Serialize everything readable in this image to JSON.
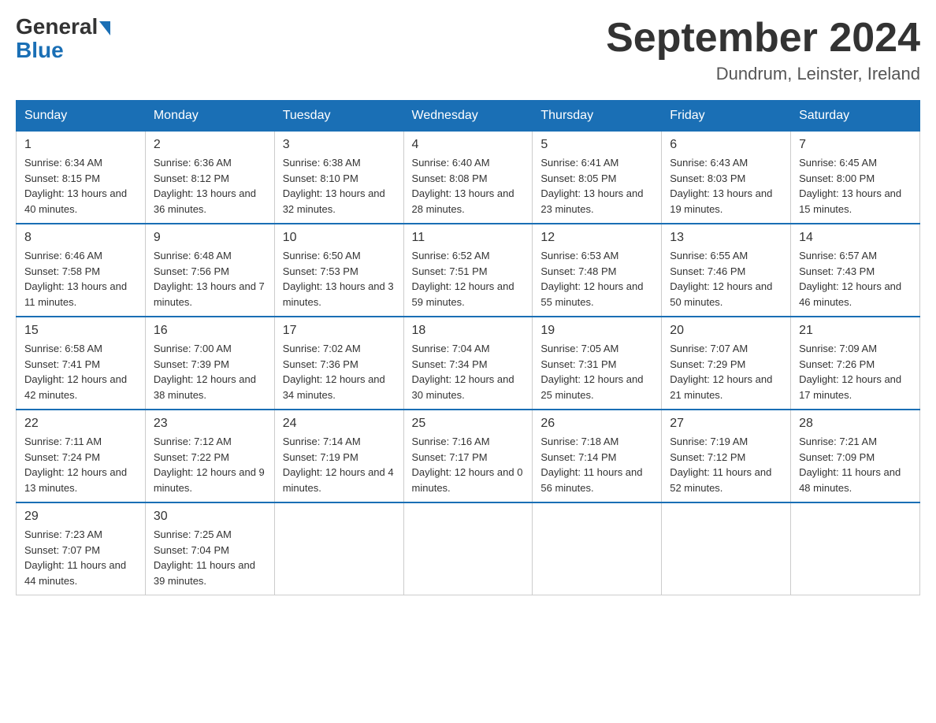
{
  "header": {
    "logo_general": "General",
    "logo_blue": "Blue",
    "month_title": "September 2024",
    "subtitle": "Dundrum, Leinster, Ireland"
  },
  "days_of_week": [
    "Sunday",
    "Monday",
    "Tuesday",
    "Wednesday",
    "Thursday",
    "Friday",
    "Saturday"
  ],
  "weeks": [
    [
      {
        "day": "1",
        "sunrise": "Sunrise: 6:34 AM",
        "sunset": "Sunset: 8:15 PM",
        "daylight": "Daylight: 13 hours and 40 minutes."
      },
      {
        "day": "2",
        "sunrise": "Sunrise: 6:36 AM",
        "sunset": "Sunset: 8:12 PM",
        "daylight": "Daylight: 13 hours and 36 minutes."
      },
      {
        "day": "3",
        "sunrise": "Sunrise: 6:38 AM",
        "sunset": "Sunset: 8:10 PM",
        "daylight": "Daylight: 13 hours and 32 minutes."
      },
      {
        "day": "4",
        "sunrise": "Sunrise: 6:40 AM",
        "sunset": "Sunset: 8:08 PM",
        "daylight": "Daylight: 13 hours and 28 minutes."
      },
      {
        "day": "5",
        "sunrise": "Sunrise: 6:41 AM",
        "sunset": "Sunset: 8:05 PM",
        "daylight": "Daylight: 13 hours and 23 minutes."
      },
      {
        "day": "6",
        "sunrise": "Sunrise: 6:43 AM",
        "sunset": "Sunset: 8:03 PM",
        "daylight": "Daylight: 13 hours and 19 minutes."
      },
      {
        "day": "7",
        "sunrise": "Sunrise: 6:45 AM",
        "sunset": "Sunset: 8:00 PM",
        "daylight": "Daylight: 13 hours and 15 minutes."
      }
    ],
    [
      {
        "day": "8",
        "sunrise": "Sunrise: 6:46 AM",
        "sunset": "Sunset: 7:58 PM",
        "daylight": "Daylight: 13 hours and 11 minutes."
      },
      {
        "day": "9",
        "sunrise": "Sunrise: 6:48 AM",
        "sunset": "Sunset: 7:56 PM",
        "daylight": "Daylight: 13 hours and 7 minutes."
      },
      {
        "day": "10",
        "sunrise": "Sunrise: 6:50 AM",
        "sunset": "Sunset: 7:53 PM",
        "daylight": "Daylight: 13 hours and 3 minutes."
      },
      {
        "day": "11",
        "sunrise": "Sunrise: 6:52 AM",
        "sunset": "Sunset: 7:51 PM",
        "daylight": "Daylight: 12 hours and 59 minutes."
      },
      {
        "day": "12",
        "sunrise": "Sunrise: 6:53 AM",
        "sunset": "Sunset: 7:48 PM",
        "daylight": "Daylight: 12 hours and 55 minutes."
      },
      {
        "day": "13",
        "sunrise": "Sunrise: 6:55 AM",
        "sunset": "Sunset: 7:46 PM",
        "daylight": "Daylight: 12 hours and 50 minutes."
      },
      {
        "day": "14",
        "sunrise": "Sunrise: 6:57 AM",
        "sunset": "Sunset: 7:43 PM",
        "daylight": "Daylight: 12 hours and 46 minutes."
      }
    ],
    [
      {
        "day": "15",
        "sunrise": "Sunrise: 6:58 AM",
        "sunset": "Sunset: 7:41 PM",
        "daylight": "Daylight: 12 hours and 42 minutes."
      },
      {
        "day": "16",
        "sunrise": "Sunrise: 7:00 AM",
        "sunset": "Sunset: 7:39 PM",
        "daylight": "Daylight: 12 hours and 38 minutes."
      },
      {
        "day": "17",
        "sunrise": "Sunrise: 7:02 AM",
        "sunset": "Sunset: 7:36 PM",
        "daylight": "Daylight: 12 hours and 34 minutes."
      },
      {
        "day": "18",
        "sunrise": "Sunrise: 7:04 AM",
        "sunset": "Sunset: 7:34 PM",
        "daylight": "Daylight: 12 hours and 30 minutes."
      },
      {
        "day": "19",
        "sunrise": "Sunrise: 7:05 AM",
        "sunset": "Sunset: 7:31 PM",
        "daylight": "Daylight: 12 hours and 25 minutes."
      },
      {
        "day": "20",
        "sunrise": "Sunrise: 7:07 AM",
        "sunset": "Sunset: 7:29 PM",
        "daylight": "Daylight: 12 hours and 21 minutes."
      },
      {
        "day": "21",
        "sunrise": "Sunrise: 7:09 AM",
        "sunset": "Sunset: 7:26 PM",
        "daylight": "Daylight: 12 hours and 17 minutes."
      }
    ],
    [
      {
        "day": "22",
        "sunrise": "Sunrise: 7:11 AM",
        "sunset": "Sunset: 7:24 PM",
        "daylight": "Daylight: 12 hours and 13 minutes."
      },
      {
        "day": "23",
        "sunrise": "Sunrise: 7:12 AM",
        "sunset": "Sunset: 7:22 PM",
        "daylight": "Daylight: 12 hours and 9 minutes."
      },
      {
        "day": "24",
        "sunrise": "Sunrise: 7:14 AM",
        "sunset": "Sunset: 7:19 PM",
        "daylight": "Daylight: 12 hours and 4 minutes."
      },
      {
        "day": "25",
        "sunrise": "Sunrise: 7:16 AM",
        "sunset": "Sunset: 7:17 PM",
        "daylight": "Daylight: 12 hours and 0 minutes."
      },
      {
        "day": "26",
        "sunrise": "Sunrise: 7:18 AM",
        "sunset": "Sunset: 7:14 PM",
        "daylight": "Daylight: 11 hours and 56 minutes."
      },
      {
        "day": "27",
        "sunrise": "Sunrise: 7:19 AM",
        "sunset": "Sunset: 7:12 PM",
        "daylight": "Daylight: 11 hours and 52 minutes."
      },
      {
        "day": "28",
        "sunrise": "Sunrise: 7:21 AM",
        "sunset": "Sunset: 7:09 PM",
        "daylight": "Daylight: 11 hours and 48 minutes."
      }
    ],
    [
      {
        "day": "29",
        "sunrise": "Sunrise: 7:23 AM",
        "sunset": "Sunset: 7:07 PM",
        "daylight": "Daylight: 11 hours and 44 minutes."
      },
      {
        "day": "30",
        "sunrise": "Sunrise: 7:25 AM",
        "sunset": "Sunset: 7:04 PM",
        "daylight": "Daylight: 11 hours and 39 minutes."
      },
      {
        "day": "",
        "sunrise": "",
        "sunset": "",
        "daylight": ""
      },
      {
        "day": "",
        "sunrise": "",
        "sunset": "",
        "daylight": ""
      },
      {
        "day": "",
        "sunrise": "",
        "sunset": "",
        "daylight": ""
      },
      {
        "day": "",
        "sunrise": "",
        "sunset": "",
        "daylight": ""
      },
      {
        "day": "",
        "sunrise": "",
        "sunset": "",
        "daylight": ""
      }
    ]
  ]
}
